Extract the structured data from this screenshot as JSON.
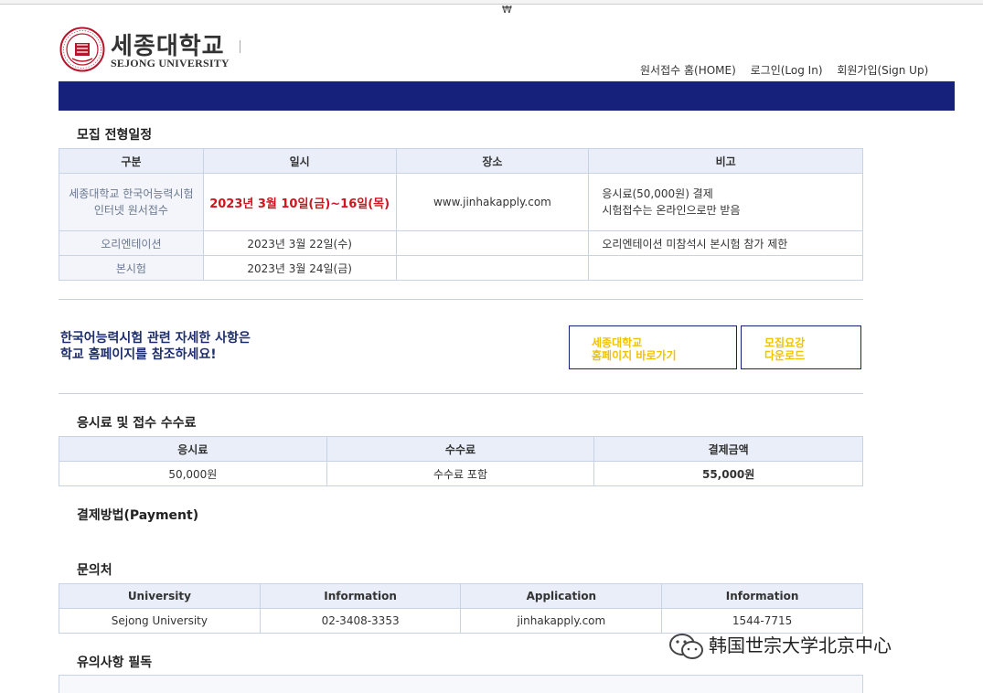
{
  "header": {
    "currency_symbol": "₩",
    "brand_ko": "세종대학교",
    "brand_en": "SEJONG UNIVERSITY",
    "nav": [
      "원서접수 홈(HOME)",
      "로그인(Log In)",
      "회원가입(Sign Up)"
    ]
  },
  "schedule": {
    "title": "모집 전형일정",
    "headers": [
      "구분",
      "일시",
      "장소",
      "비고"
    ],
    "rows": [
      {
        "label": "세종대학교 한국어능력시험\n인터넷 원서접수",
        "date": "2023년 3월 10일(금)~16일(목)",
        "place": "www.jinhakapply.com",
        "note": "응시료(50,000원) 결제\n시험접수는 온라인으로만 받음"
      },
      {
        "label": "오리엔테이션",
        "date": "2023년 3월 22일(수)",
        "place": "",
        "note": "오리엔테이션 미참석시 본시험 참가 제한"
      },
      {
        "label": "본시험",
        "date": "2023년 3월 24일(금)",
        "place": "",
        "note": ""
      }
    ]
  },
  "info": {
    "text_line1": "한국어능력시험 관련 자세한 사항은",
    "text_line2": "학교 홈페이지를 참조하세요!",
    "btn_home_line1": "세종대학교",
    "btn_home_line2": "홈페이지 바로가기",
    "btn_guide_line1": "모집요강",
    "btn_guide_line2": "다운로드"
  },
  "fee": {
    "title": "응시료 및 접수 수수료",
    "headers": [
      "응시료",
      "수수료",
      "결제금액"
    ],
    "values": [
      "50,000원",
      "수수료 포함",
      "55,000원"
    ]
  },
  "payment": {
    "title": "결제방법(Payment)"
  },
  "contact": {
    "title": "문의처",
    "headers": [
      "University",
      "Information",
      "Application",
      "Information"
    ],
    "values": [
      "Sejong University",
      "02-3408-3353",
      "jinhakapply.com",
      "1544-7715"
    ]
  },
  "notice": {
    "title": "유의사항 필독"
  },
  "watermark": {
    "text": "韩国世宗大学北京中心"
  },
  "colors": {
    "navbar": "#15217a",
    "highlight_red": "#d0141e",
    "button_text": "#f0c300",
    "table_header_bg": "#e9eef8"
  }
}
